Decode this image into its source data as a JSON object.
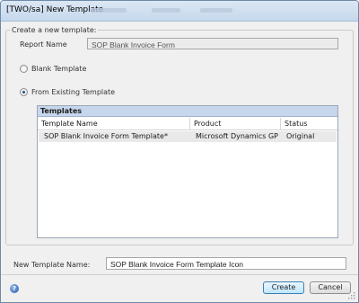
{
  "window": {
    "title": "[TWO/sa] New Template"
  },
  "group": {
    "legend": "Create a new template:"
  },
  "report_name": {
    "label": "Report Name",
    "value": "SOP Blank Invoice Form"
  },
  "options": {
    "blank_template": "Blank Template",
    "from_existing": "From Existing Template",
    "selected": "From Existing Template"
  },
  "templates": {
    "title": "Templates",
    "columns": [
      "Template Name",
      "Product",
      "Status"
    ],
    "rows": [
      {
        "name": "SOP Blank Invoice Form Template*",
        "product": "Microsoft Dynamics GP",
        "status": "Original"
      }
    ]
  },
  "new_template_name": {
    "label": "New Template Name:",
    "value": "SOP Blank Invoice Form Template Icon"
  },
  "buttons": {
    "create": "Create",
    "cancel": "Cancel"
  },
  "icons": {
    "help": "help-icon"
  }
}
